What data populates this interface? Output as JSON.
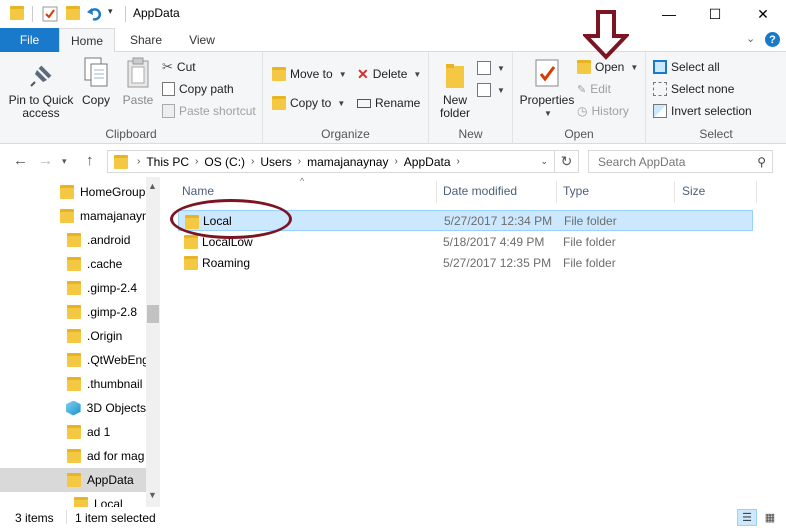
{
  "window": {
    "title": "AppData",
    "minimize": "—",
    "maximize": "☐",
    "close": "✕"
  },
  "ribbon_tabs": {
    "file": "File",
    "home": "Home",
    "share": "Share",
    "view": "View",
    "collapse": "⌄",
    "help": "?"
  },
  "clipboard": {
    "label": "Clipboard",
    "pin_line1": "Pin to Quick",
    "pin_line2": "access",
    "copy": "Copy",
    "paste": "Paste",
    "cut": "Cut",
    "copy_path": "Copy path",
    "paste_shortcut": "Paste shortcut"
  },
  "organize": {
    "label": "Organize",
    "move_to": "Move to",
    "copy_to": "Copy to",
    "delete": "Delete",
    "rename": "Rename"
  },
  "new_group": {
    "label": "New",
    "new_folder_line1": "New",
    "new_folder_line2": "folder"
  },
  "open_group": {
    "label": "Open",
    "properties": "Properties",
    "open": "Open",
    "edit": "Edit",
    "history": "History"
  },
  "select_group": {
    "label": "Select",
    "select_all": "Select all",
    "select_none": "Select none",
    "invert_selection": "Invert selection"
  },
  "address": {
    "crumbs": [
      "This PC",
      "OS (C:)",
      "Users",
      "mamajanaynay",
      "AppData"
    ],
    "search_placeholder": "Search AppData"
  },
  "nav_pane": {
    "items": [
      {
        "label": "HomeGroup",
        "icon": "homegroup-icon"
      },
      {
        "label": "mamajanaynay",
        "icon": "user-folder-icon"
      },
      {
        "label": ".android",
        "icon": "folder-icon"
      },
      {
        "label": ".cache",
        "icon": "folder-icon"
      },
      {
        "label": ".gimp-2.4",
        "icon": "folder-icon"
      },
      {
        "label": ".gimp-2.8",
        "icon": "folder-icon"
      },
      {
        "label": ".Origin",
        "icon": "folder-icon"
      },
      {
        "label": ".QtWebEng",
        "icon": "folder-icon"
      },
      {
        "label": ".thumbnail",
        "icon": "folder-icon"
      },
      {
        "label": "3D Objects",
        "icon": "3d-objects-icon"
      },
      {
        "label": "ad 1",
        "icon": "folder-icon"
      },
      {
        "label": "ad for mag",
        "icon": "folder-icon"
      },
      {
        "label": "AppData",
        "icon": "folder-icon"
      },
      {
        "label": "Local",
        "icon": "folder-icon"
      }
    ]
  },
  "file_list": {
    "columns": {
      "name": "Name",
      "date": "Date modified",
      "type": "Type",
      "size": "Size"
    },
    "rows": [
      {
        "name": "Local",
        "date": "5/27/2017 12:34 PM",
        "type": "File folder"
      },
      {
        "name": "LocalLow",
        "date": "5/18/2017 4:49 PM",
        "type": "File folder"
      },
      {
        "name": "Roaming",
        "date": "5/27/2017 12:35 PM",
        "type": "File folder"
      }
    ]
  },
  "status": {
    "item_count": "3 items",
    "selected": "1 item selected"
  },
  "colors": {
    "accent": "#1979ca",
    "selection": "#cce8ff",
    "annotation": "#7b1523"
  }
}
